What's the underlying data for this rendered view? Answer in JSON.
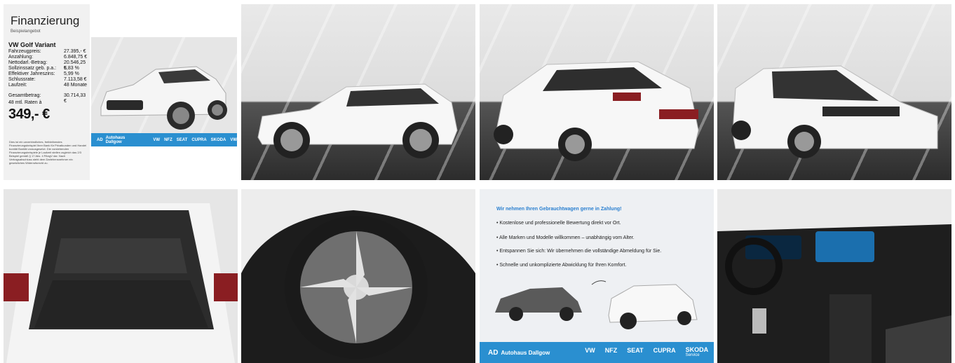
{
  "finance": {
    "title": "Finanzierung",
    "subtitle": "Beispielangebot",
    "model": "VW Golf Variant",
    "rows": [
      {
        "label": "Fahrzeugpreis:",
        "value": "27.395,- €"
      },
      {
        "label": "Anzahlung:",
        "value": "6.848,75 €"
      },
      {
        "label": "Nettodarl.-Betrag:",
        "value": "20.546,25 €"
      },
      {
        "label": "Sollzinssatz geb. p.a.:",
        "value": "5,83 %"
      },
      {
        "label": "Effektiver Jahreszins:",
        "value": "5,99 %"
      },
      {
        "label": "Schlussrate:",
        "value": "7.113,58 €"
      },
      {
        "label": "Laufzeit:",
        "value": "48 Monate"
      }
    ],
    "total_label": "Gesamtbetrag:",
    "total_value": "30.714,33 €",
    "rates_label": "48 mtl. Raten à",
    "rate_price": "349,- €",
    "disclaimer": "Dies ist ein unverbindliches, freibleibendes Finanzierungsbeispiel Ihrer Bank für Privatkunden und Handel bonität Bonität vorausgesetzt. Die vorstehenden Finanzierungsbeispiele je Laufzeit stellen zugleich das 2/3 Beispiel gemäß § 17 Abs. 4 PAngV dar. Nach Vertragsabschluss steht dem Darlehensnehmer ein gesetzliches Widerrufsrecht zu.",
    "bar_logo": "AD",
    "bar_brand": "Autohaus Dallgow",
    "bar_icons": [
      "VW",
      "NFZ",
      "SEAT",
      "CUPRA",
      "SKODA",
      "VW"
    ]
  },
  "trade": {
    "heading": "Wir nehmen Ihren Gebrauchtwagen gerne in Zahlung!",
    "items": [
      "Kostenlose und professionelle Bewertung direkt vor Ort.",
      "Alle Marken und Modelle willkommen – unabhängig vom Alter.",
      "Entspannen Sie sich: Wir übernehmen die vollständige Abmeldung für Sie.",
      "Schnelle und unkomplizierte Abwicklung für Ihren Komfort."
    ],
    "bar_logo": "AD",
    "bar_brand": "Autohaus Dallgow",
    "bar_icons": [
      "VW",
      "NFZ",
      "SEAT",
      "CUPRA"
    ],
    "skoda": "SKODA",
    "skoda_sub": "Service"
  },
  "colors": {
    "accent": "#2a8fd0",
    "heading_blue": "#2a7fd0"
  }
}
